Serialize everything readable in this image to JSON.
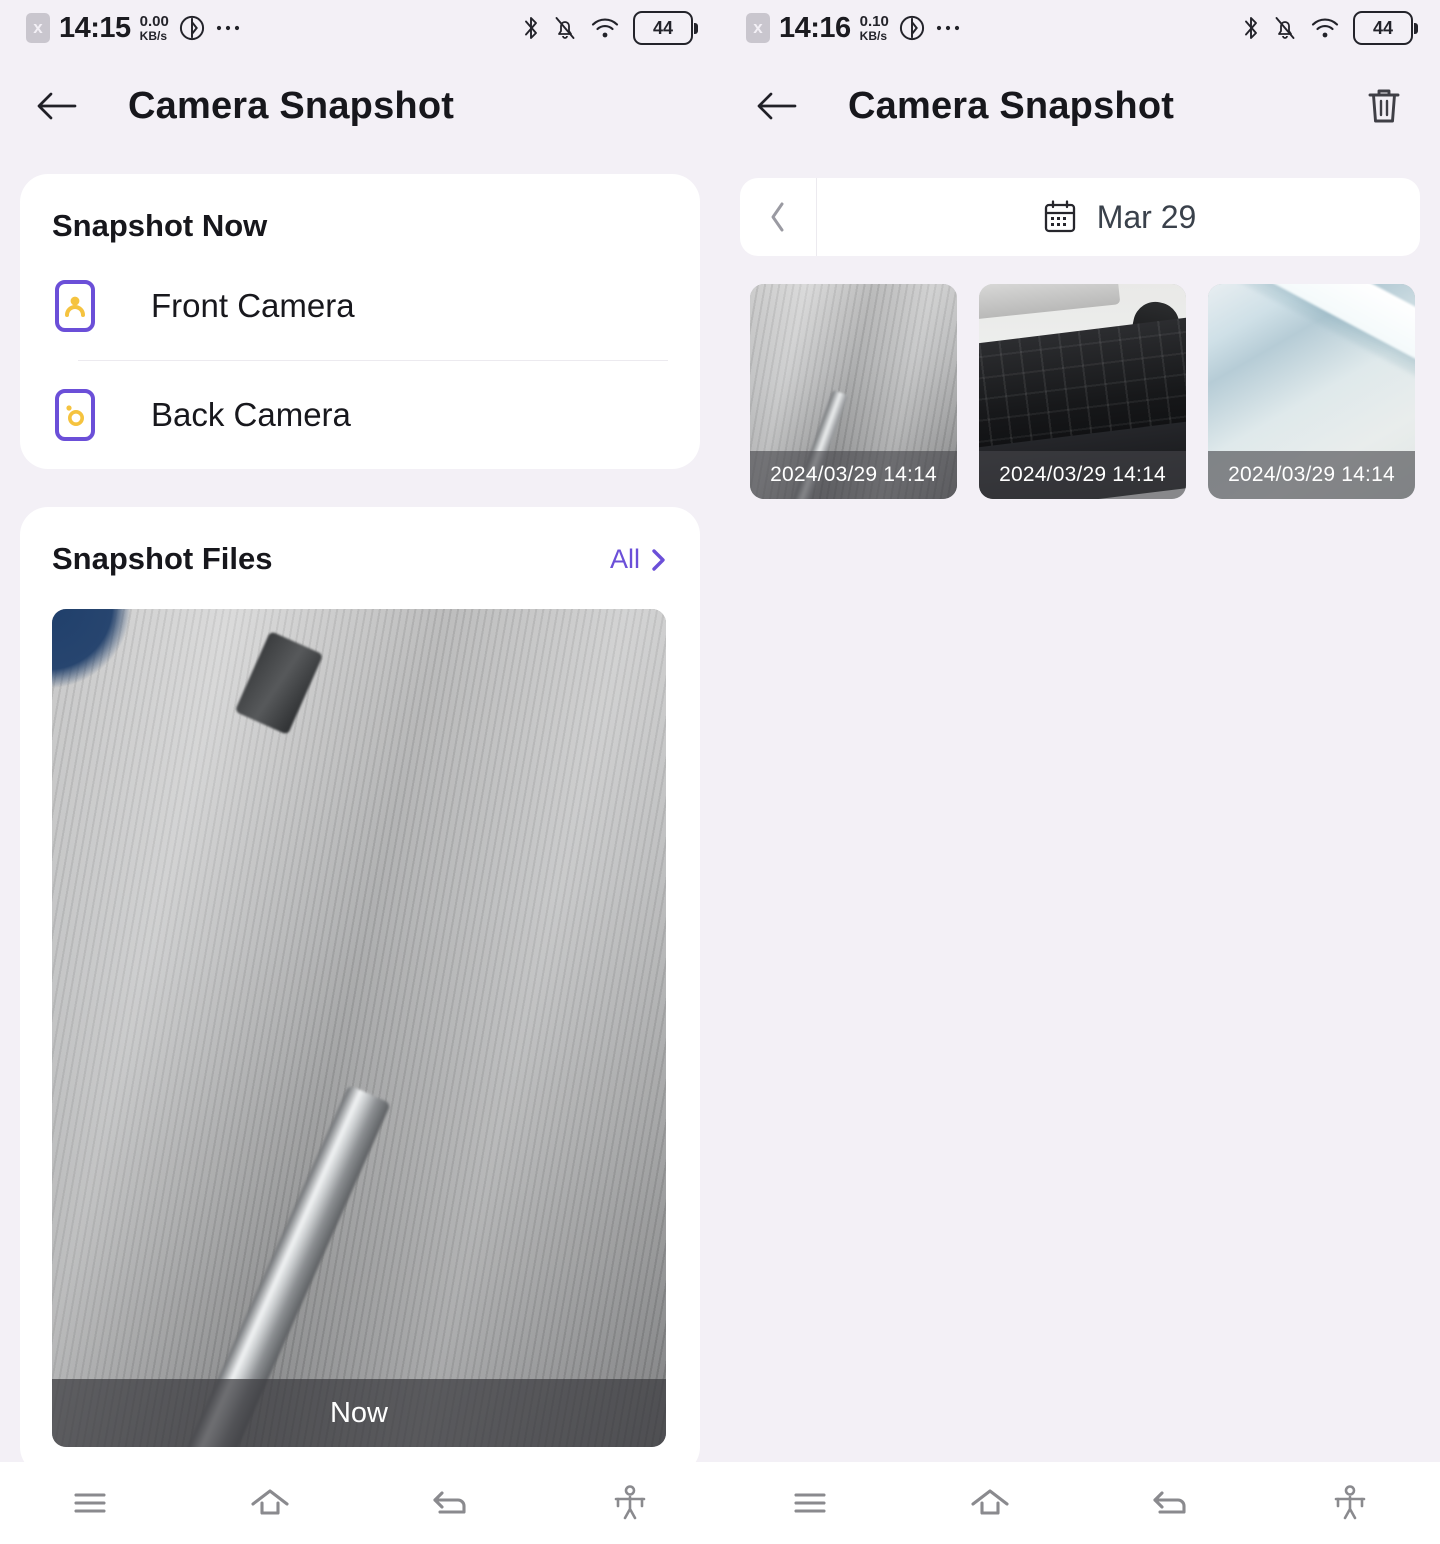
{
  "screens": [
    {
      "id": "left",
      "status": {
        "sim_label": "x",
        "time": "14:15",
        "net_speed_value": "0.00",
        "net_speed_unit": "KB/s",
        "battery": "44",
        "icons": [
          "sim-x-icon",
          "volume-sound-icon",
          "more-dots-icon",
          "bluetooth-icon",
          "mute-bell-icon",
          "wifi-icon",
          "battery-icon"
        ]
      },
      "appbar": {
        "title": "Camera Snapshot",
        "back_icon": "back-arrow-icon",
        "has_trash": false
      },
      "snapshot_now": {
        "title": "Snapshot Now",
        "items": [
          {
            "label": "Front Camera",
            "icon": "front-camera-icon"
          },
          {
            "label": "Back Camera",
            "icon": "back-camera-icon"
          }
        ]
      },
      "snapshot_files": {
        "title": "Snapshot Files",
        "all_label": "All",
        "all_chevron_icon": "chevron-right-icon",
        "preview_caption": "Now"
      },
      "nav": [
        {
          "name": "menu-icon"
        },
        {
          "name": "home-icon"
        },
        {
          "name": "back-icon"
        },
        {
          "name": "accessibility-icon"
        }
      ]
    },
    {
      "id": "right",
      "status": {
        "sim_label": "x",
        "time": "14:16",
        "net_speed_value": "0.10",
        "net_speed_unit": "KB/s",
        "battery": "44",
        "icons": [
          "sim-x-icon",
          "volume-sound-icon",
          "more-dots-icon",
          "bluetooth-icon",
          "mute-bell-icon",
          "wifi-icon",
          "battery-icon"
        ]
      },
      "appbar": {
        "title": "Camera Snapshot",
        "back_icon": "back-arrow-icon",
        "trash_icon": "trash-icon",
        "has_trash": true
      },
      "datebar": {
        "prev_icon": "chevron-left-icon",
        "calendar_icon": "calendar-icon",
        "date": "Mar 29"
      },
      "thumbnails": [
        {
          "caption": "2024/03/29 14:14",
          "scene": "concrete"
        },
        {
          "caption": "2024/03/29 14:14",
          "scene": "keyboard"
        },
        {
          "caption": "2024/03/29 14:14",
          "scene": "ceiling"
        }
      ],
      "nav": [
        {
          "name": "menu-icon"
        },
        {
          "name": "home-icon"
        },
        {
          "name": "back-icon"
        },
        {
          "name": "accessibility-icon"
        }
      ]
    }
  ],
  "colors": {
    "background": "#f3f0f6",
    "card": "#ffffff",
    "accent_purple": "#6b4fd8",
    "icon_yellow": "#f5c33f",
    "text_primary": "#17171c",
    "nav_icon": "#8a8a8e"
  }
}
